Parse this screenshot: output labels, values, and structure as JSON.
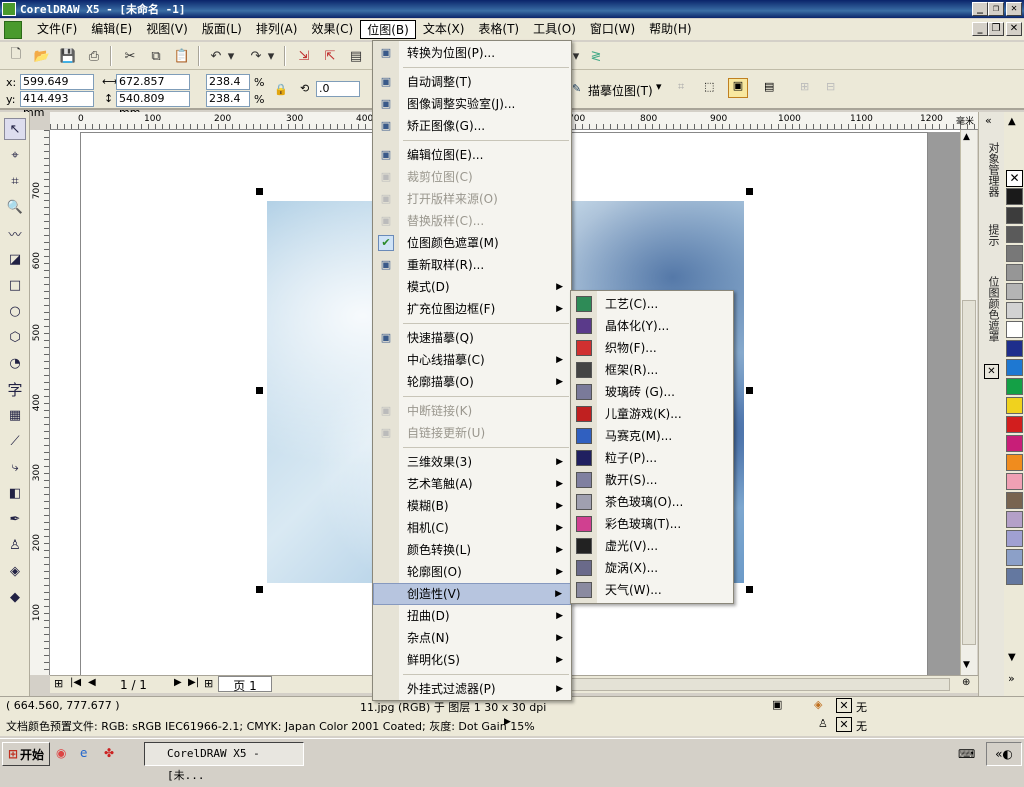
{
  "window": {
    "title": "CorelDRAW X5 - [未命名 -1]"
  },
  "menubar": [
    {
      "label": "文件(F)"
    },
    {
      "label": "编辑(E)"
    },
    {
      "label": "视图(V)"
    },
    {
      "label": "版面(L)"
    },
    {
      "label": "排列(A)"
    },
    {
      "label": "效果(C)"
    },
    {
      "label": "位图(B)"
    },
    {
      "label": "文本(X)"
    },
    {
      "label": "表格(T)"
    },
    {
      "label": "工具(O)"
    },
    {
      "label": "窗口(W)"
    },
    {
      "label": "帮助(H)"
    }
  ],
  "propbar": {
    "x": "599.649 mm",
    "y": "414.493 mm",
    "w": "672.857 mm",
    "h": "540.809 mm",
    "scale_x": "238.4",
    "scale_y": "238.4",
    "percent": "%",
    "rotation": ".0",
    "trace_label": "描摹位图(T)"
  },
  "ruler": {
    "unit": "毫米",
    "h_ticks": [
      "100",
      "0",
      "100",
      "200",
      "300",
      "400",
      "700",
      "800",
      "900",
      "1000",
      "1100",
      "1200"
    ],
    "v_ticks": [
      "700",
      "600",
      "500",
      "400",
      "300",
      "200",
      "100"
    ]
  },
  "bitmap_menu": [
    {
      "label": "转换为位图(P)...",
      "icon": "convert-icon",
      "disabled": false
    },
    {
      "sep": true
    },
    {
      "label": "自动调整(T)",
      "icon": "auto-adjust-icon",
      "disabled": false
    },
    {
      "label": "图像调整实验室(J)...",
      "icon": "image-lab-icon",
      "disabled": false
    },
    {
      "label": "矫正图像(G)...",
      "icon": "straighten-icon",
      "disabled": false
    },
    {
      "sep": true
    },
    {
      "label": "编辑位图(E)...",
      "icon": "edit-bitmap-icon",
      "disabled": false
    },
    {
      "label": "裁剪位图(C)",
      "icon": "crop-icon",
      "disabled": true
    },
    {
      "label": "打开版样来源(O)",
      "icon": "open-source-icon",
      "disabled": true
    },
    {
      "label": "替换版样(C)...",
      "icon": "replace-icon",
      "disabled": true
    },
    {
      "label": "位图颜色遮罩(M)",
      "icon": "check-icon",
      "disabled": false
    },
    {
      "label": "重新取样(R)...",
      "icon": "resample-icon",
      "disabled": false
    },
    {
      "label": "模式(D)",
      "icon": "",
      "disabled": false,
      "submenu": true
    },
    {
      "label": "扩充位图边框(F)",
      "icon": "",
      "disabled": false,
      "submenu": true
    },
    {
      "sep": true
    },
    {
      "label": "快速描摹(Q)",
      "icon": "quick-trace-icon",
      "disabled": false
    },
    {
      "label": "中心线描摹(C)",
      "icon": "",
      "disabled": false,
      "submenu": true
    },
    {
      "label": "轮廓描摹(O)",
      "icon": "",
      "disabled": false,
      "submenu": true
    },
    {
      "sep": true
    },
    {
      "label": "中断链接(K)",
      "icon": "break-link-icon",
      "disabled": true
    },
    {
      "label": "自链接更新(U)",
      "icon": "update-link-icon",
      "disabled": true
    },
    {
      "sep": true
    },
    {
      "label": "三维效果(3)",
      "icon": "",
      "disabled": false,
      "submenu": true
    },
    {
      "label": "艺术笔触(A)",
      "icon": "",
      "disabled": false,
      "submenu": true
    },
    {
      "label": "模糊(B)",
      "icon": "",
      "disabled": false,
      "submenu": true
    },
    {
      "label": "相机(C)",
      "icon": "",
      "disabled": false,
      "submenu": true
    },
    {
      "label": "颜色转换(L)",
      "icon": "",
      "disabled": false,
      "submenu": true
    },
    {
      "label": "轮廓图(O)",
      "icon": "",
      "disabled": false,
      "submenu": true
    },
    {
      "label": "创造性(V)",
      "icon": "",
      "disabled": false,
      "submenu": true,
      "selected": true
    },
    {
      "label": "扭曲(D)",
      "icon": "",
      "disabled": false,
      "submenu": true
    },
    {
      "label": "杂点(N)",
      "icon": "",
      "disabled": false,
      "submenu": true
    },
    {
      "label": "鲜明化(S)",
      "icon": "",
      "disabled": false,
      "submenu": true
    },
    {
      "sep": true
    },
    {
      "label": "外挂式过滤器(P)",
      "icon": "",
      "disabled": false,
      "submenu": true
    }
  ],
  "creative_submenu": [
    {
      "label": "工艺(C)...",
      "color": "#2e8b57"
    },
    {
      "label": "晶体化(Y)...",
      "color": "#5a3a8a"
    },
    {
      "label": "织物(F)...",
      "color": "#d03030"
    },
    {
      "label": "框架(R)...",
      "color": "#444444"
    },
    {
      "label": "玻璃砖 (G)...",
      "color": "#7a7a9a"
    },
    {
      "label": "儿童游戏(K)...",
      "color": "#c02020"
    },
    {
      "label": "马赛克(M)...",
      "color": "#3060c0"
    },
    {
      "label": "粒子(P)...",
      "color": "#202060"
    },
    {
      "label": "散开(S)...",
      "color": "#8080a0"
    },
    {
      "label": "茶色玻璃(O)...",
      "color": "#a0a0b0"
    },
    {
      "label": "彩色玻璃(T)...",
      "color": "#d04090"
    },
    {
      "label": "虚光(V)...",
      "color": "#222222"
    },
    {
      "label": "旋涡(X)...",
      "color": "#6a6a8a"
    },
    {
      "label": "天气(W)...",
      "color": "#8a8aa0"
    }
  ],
  "palette": [
    "#1a1a1a",
    "#3c3c3c",
    "#5a5a5a",
    "#787878",
    "#969696",
    "#b4b4b4",
    "#d2d2d2",
    "#ffffff",
    "#1e2e8c",
    "#1e78d2",
    "#14a046",
    "#f0d21e",
    "#d21e1e",
    "#c81e78",
    "#f08c1e",
    "#f0a0b4",
    "#786450",
    "#b4a0c8",
    "#a0a0d2",
    "#8ca0c8",
    "#6478a0"
  ],
  "docker": {
    "tab1": "对象管理器",
    "tab2": "提示",
    "tab3": "位图颜色遮罩"
  },
  "statusbar": {
    "coords": "( 664.560, 777.677 )",
    "object_info": "11.jpg (RGB) 于 图层 1 30 x 30 dpi",
    "color_profile": "文档颜色预置文件: RGB: sRGB IEC61966-2.1; CMYK: Japan Color 2001 Coated; 灰度: Dot Gain 15%",
    "fill_none": "无",
    "outline_none": "无",
    "page_count": "1 / 1",
    "page_tab": "页 1"
  },
  "taskbar": {
    "start": "开始",
    "task": "CorelDRAW X5 - [未..."
  }
}
